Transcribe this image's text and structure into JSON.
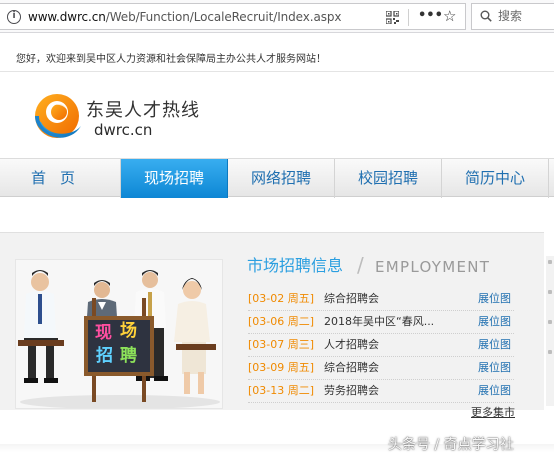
{
  "browser": {
    "url_host": "www.dwrc.cn",
    "url_path": "/Web/Function/LocaleRecruit/Index.aspx",
    "more_glyph": "•••",
    "star_glyph": "☆",
    "search_placeholder": "搜索"
  },
  "site": {
    "welcome": "您好，欢迎来到吴中区人力资源和社会保障局主办公共人才服务网站！",
    "logo_cn": "东吴人才热线",
    "logo_en": "dwrc.cn"
  },
  "nav": {
    "items": [
      {
        "label": "首页"
      },
      {
        "label": "现场招聘"
      },
      {
        "label": "网络招聘"
      },
      {
        "label": "校园招聘"
      },
      {
        "label": "简历中心"
      }
    ],
    "active_color": "#1a95e0"
  },
  "recruit": {
    "title": "市场招聘信息",
    "title_en": "EMPLOYMENT",
    "photo_sign": [
      "现",
      "场",
      "招",
      "聘"
    ],
    "jobs": [
      {
        "date": "[03-02 周五]",
        "name": "综合招聘会",
        "link": "展位图"
      },
      {
        "date": "[03-06 周二]",
        "name": "2018年吴中区“春风...",
        "link": "展位图"
      },
      {
        "date": "[03-07 周三]",
        "name": "人才招聘会",
        "link": "展位图"
      },
      {
        "date": "[03-09 周五]",
        "name": "综合招聘会",
        "link": "展位图"
      },
      {
        "date": "[03-13 周二]",
        "name": "劳务招聘会",
        "link": "展位图"
      }
    ],
    "more": "更多集市"
  },
  "watermark": "头条号 / 奇点学习社",
  "colors": {
    "accent_blue": "#2b9fe0",
    "date_orange": "#f08a00",
    "link_blue": "#1f6fb0"
  }
}
